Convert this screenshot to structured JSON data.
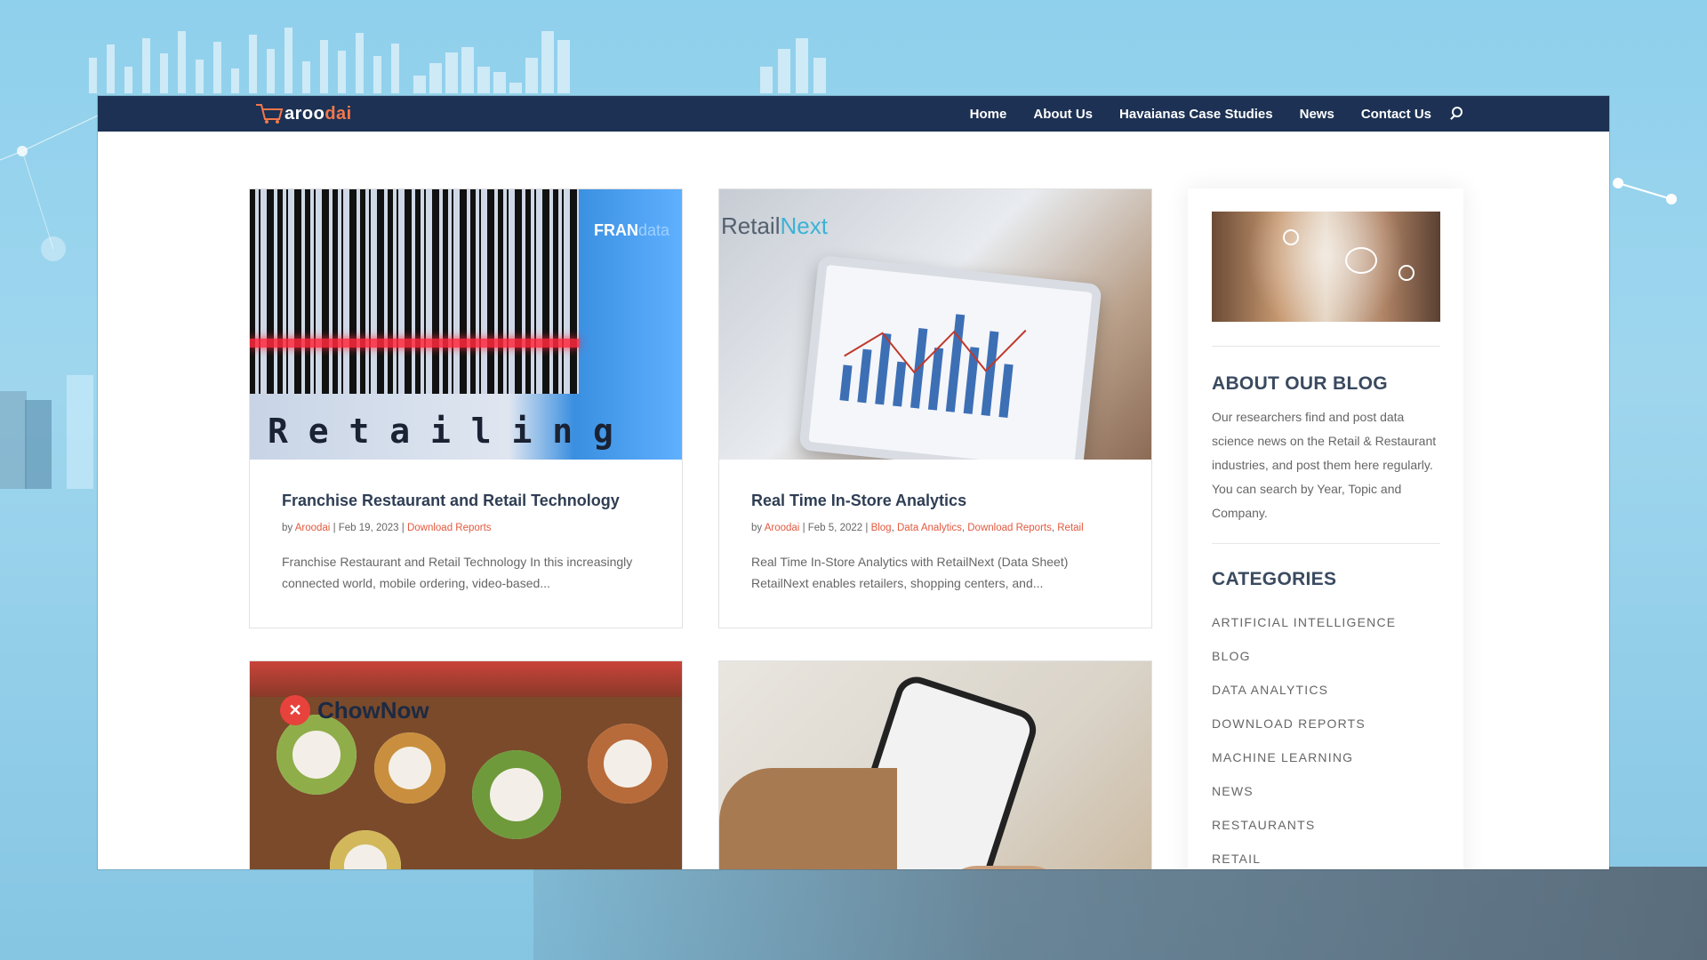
{
  "nav": {
    "logo_prefix": "aroo",
    "logo_suffix": "dai",
    "links": [
      "Home",
      "About Us",
      "Havaianas Case Studies",
      "News",
      "Contact Us"
    ]
  },
  "posts": [
    {
      "title": "Franchise Restaurant and Retail Technology",
      "author": "Aroodai",
      "date": "Feb 19, 2023",
      "categories": [
        "Download Reports"
      ],
      "excerpt_1": "Franchise Restaurant and Retail Technology In this increasingly",
      "excerpt_2": "connected world, mobile ordering, video-based...",
      "image_brand": "FRAN",
      "image_brand_suffix": "data",
      "image_word": "R e t a i l i n g"
    },
    {
      "title": "Real Time In-Store Analytics",
      "author": "Aroodai",
      "date": "Feb 5, 2022",
      "categories": [
        "Blog",
        "Data Analytics",
        "Download Reports",
        "Retail"
      ],
      "excerpt_1": "Real Time In-Store Analytics with RetailNext (Data Sheet)",
      "excerpt_2": "RetailNext enables retailers, shopping centers, and...",
      "image_brand": "Retail",
      "image_brand_suffix": "Next"
    },
    {
      "image_brand": "ChowNow"
    },
    {}
  ],
  "meta": {
    "by": "by",
    "sep": "|"
  },
  "sidebar": {
    "about_title": "ABOUT OUR BLOG",
    "about_text": "Our researchers find and post data science news on the Retail & Restaurant industries, and post them here regularly. You can search by Year, Topic and Company.",
    "categories_title": "CATEGORIES",
    "categories": [
      "ARTIFICIAL INTELLIGENCE",
      "BLOG",
      "DATA ANALYTICS",
      "DOWNLOAD REPORTS",
      "MACHINE LEARNING",
      "NEWS",
      "RESTAURANTS",
      "RETAIL"
    ]
  },
  "colors": {
    "nav_bg": "#1c3153",
    "accent": "#e3593f",
    "title": "#2f3e54"
  }
}
